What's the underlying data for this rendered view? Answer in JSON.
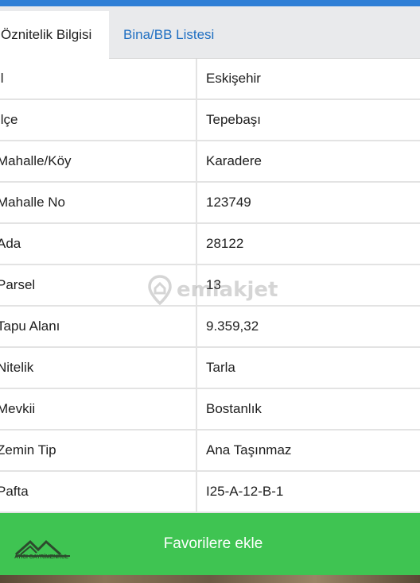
{
  "tabs": [
    {
      "label": "Öznitelik Bilgisi",
      "active": true
    },
    {
      "label": "Bina/BB Listesi",
      "active": false
    }
  ],
  "rows": [
    {
      "label": "İl",
      "value": "Eskişehir"
    },
    {
      "label": "İlçe",
      "value": "Tepebaşı"
    },
    {
      "label": "Mahalle/Köy",
      "value": "Karadere"
    },
    {
      "label": "Mahalle No",
      "value": "123749"
    },
    {
      "label": "Ada",
      "value": "28122"
    },
    {
      "label": "Parsel",
      "value": "13"
    },
    {
      "label": "Tapu Alanı",
      "value": "9.359,32"
    },
    {
      "label": "Nitelik",
      "value": "Tarla"
    },
    {
      "label": "Mevkii",
      "value": "Bostanlık"
    },
    {
      "label": "Zemin Tip",
      "value": "Ana Taşınmaz"
    },
    {
      "label": "Pafta",
      "value": "I25-A-12-B-1"
    }
  ],
  "watermark": {
    "text": "emlakjet"
  },
  "favorite_button": {
    "label": "Favorilere ekle"
  },
  "brand": {
    "text": "ATICI GAYRİMENKUL"
  },
  "colors": {
    "accent_blue": "#1f6fc2",
    "favorite_green": "#3fc452"
  }
}
